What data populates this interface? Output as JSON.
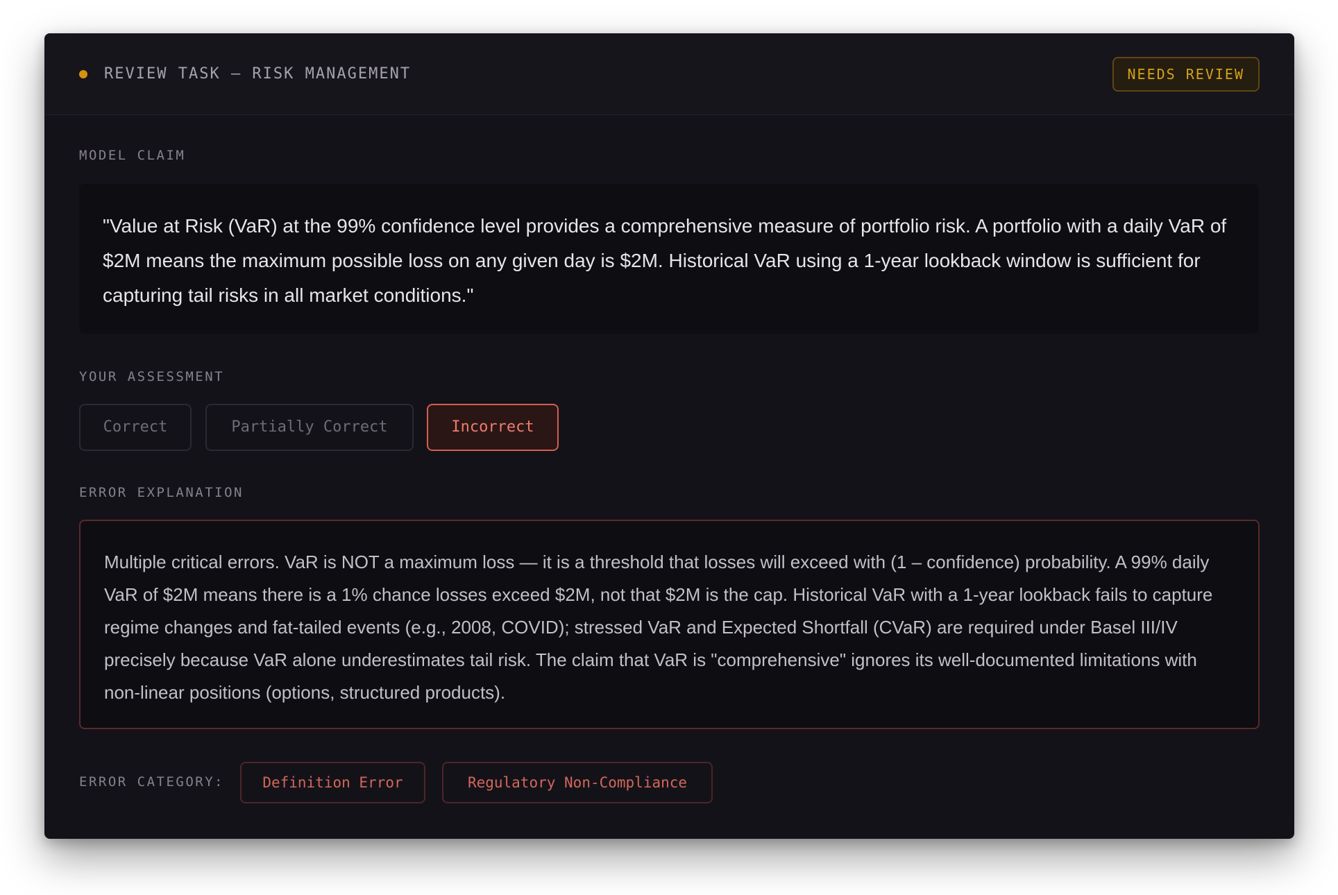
{
  "header": {
    "title": "REVIEW TASK — RISK MANAGEMENT",
    "status_badge": "NEEDS REVIEW",
    "status_color": "#d4920f"
  },
  "claim": {
    "label": "MODEL CLAIM",
    "text": "\"Value at Risk (VaR) at the 99% confidence level provides a comprehensive measure of portfolio risk. A portfolio with a daily VaR of $2M means the maximum possible loss on any given day is $2M. Historical VaR using a 1-year lookback window is sufficient for capturing tail risks in all market conditions.\""
  },
  "assessment": {
    "label": "YOUR ASSESSMENT",
    "options": [
      {
        "label": "Correct",
        "selected": false
      },
      {
        "label": "Partially Correct",
        "selected": false
      },
      {
        "label": "Incorrect",
        "selected": true
      }
    ],
    "selected_color": "#d55e4e"
  },
  "explanation": {
    "label": "ERROR EXPLANATION",
    "text": "Multiple critical errors. VaR is NOT a maximum loss — it is a threshold that losses will exceed with (1 – confidence) probability. A 99% daily VaR of $2M means there is a 1% chance losses exceed $2M, not that $2M is the cap. Historical VaR with a 1-year lookback fails to capture regime changes and fat-tailed events (e.g., 2008, COVID); stressed VaR and Expected Shortfall (CVaR) are required under Basel III/IV precisely because VaR alone underestimates tail risk. The claim that VaR is \"comprehensive\" ignores its well-documented limitations with non-linear positions (options, structured products)."
  },
  "error_category": {
    "label": "ERROR CATEGORY:",
    "tags": [
      "Definition Error",
      "Regulatory Non-Compliance"
    ],
    "tag_color": "#d2675a"
  }
}
